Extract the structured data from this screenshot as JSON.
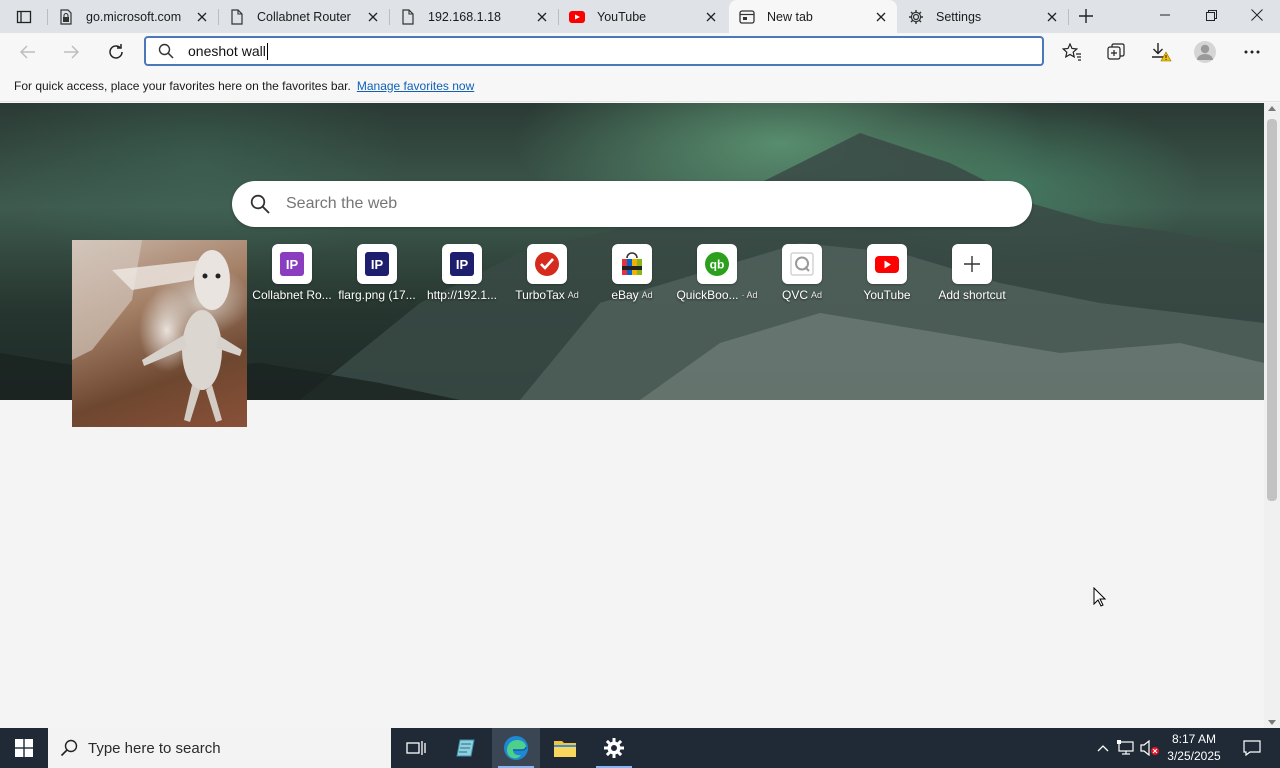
{
  "browser": {
    "tabs": [
      {
        "title": "go.microsoft.com",
        "icon": "page-lock-icon"
      },
      {
        "title": "Collabnet Router",
        "icon": "page-icon"
      },
      {
        "title": "192.168.1.18",
        "icon": "page-icon"
      },
      {
        "title": "YouTube",
        "icon": "youtube-icon"
      },
      {
        "title": "New tab",
        "icon": "newtab-icon",
        "active": true
      },
      {
        "title": "Settings",
        "icon": "gear-icon"
      }
    ],
    "address_bar": {
      "value": "oneshot wall"
    },
    "favorites_bar": {
      "message": "For quick access, place your favorites here on the favorites bar.",
      "link": "Manage favorites now"
    }
  },
  "newtab": {
    "search_placeholder": "Search the web",
    "shortcuts": [
      {
        "label": "Collabnet Ro...",
        "icon": "ip-icon",
        "color": "#8a3ebf",
        "ad": ""
      },
      {
        "label": "flarg.png (17...",
        "icon": "ip-icon",
        "color": "#1e1e6e",
        "ad": ""
      },
      {
        "label": "http://192.1...",
        "icon": "ip-icon",
        "color": "#1e1e6e",
        "ad": ""
      },
      {
        "label": "TurboTax",
        "icon": "turbotax-icon",
        "color": "#d52b1e",
        "ad": "Ad"
      },
      {
        "label": "eBay",
        "icon": "ebay-icon",
        "color": "#333333",
        "ad": "Ad"
      },
      {
        "label": "QuickBoo...",
        "icon": "quickbooks-icon",
        "color": "#2ca01c",
        "ad": "· Ad"
      },
      {
        "label": "QVC",
        "icon": "qvc-icon",
        "color": "#c00000",
        "ad": "Ad"
      },
      {
        "label": "YouTube",
        "icon": "youtube-icon",
        "color": "#ff0000",
        "ad": ""
      },
      {
        "label": "Add shortcut",
        "icon": "plus-icon",
        "color": "#333333",
        "ad": ""
      }
    ],
    "ip_text": "IP"
  },
  "taskbar": {
    "search_placeholder": "Type here to search",
    "time": "8:17 AM",
    "date": "3/25/2025"
  },
  "colors": {
    "accent": "#4a78b8",
    "link": "#1160b8",
    "taskbar": "#1f2a36"
  }
}
